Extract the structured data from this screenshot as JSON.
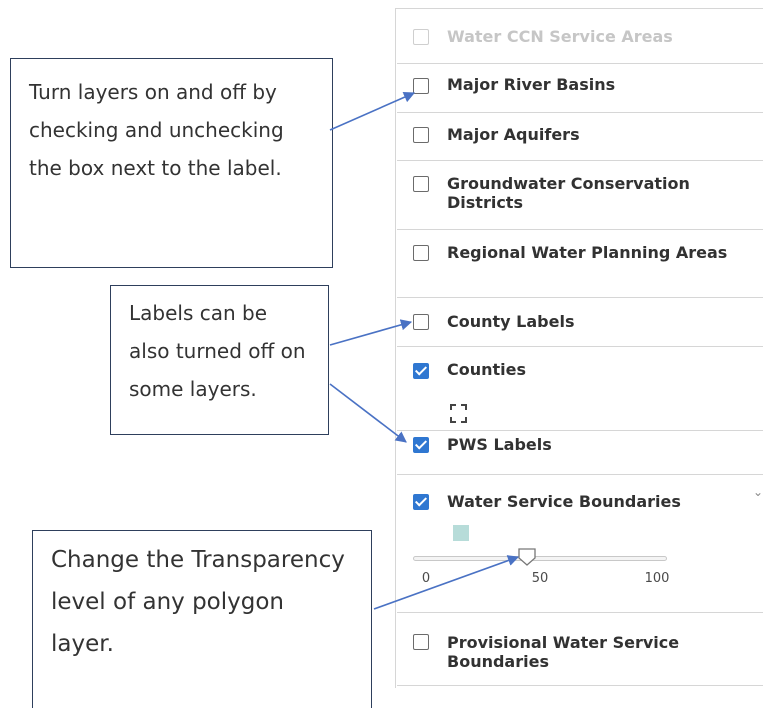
{
  "layers": [
    {
      "label": "Water CCN Service Areas",
      "checked": false,
      "disabled": true
    },
    {
      "label": "Major River Basins",
      "checked": false,
      "disabled": false
    },
    {
      "label": "Major Aquifers",
      "checked": false,
      "disabled": false
    },
    {
      "label": "Groundwater Conservation Districts",
      "checked": false,
      "disabled": false
    },
    {
      "label": "Regional Water Planning Areas",
      "checked": false,
      "disabled": false
    },
    {
      "label": "County Labels",
      "checked": false,
      "disabled": false
    },
    {
      "label": "Counties",
      "checked": true,
      "disabled": false
    },
    {
      "label": "PWS Labels",
      "checked": true,
      "disabled": false
    },
    {
      "label": "Water Service Boundaries",
      "checked": true,
      "disabled": false
    },
    {
      "label": "Provisional Water Service Boundaries",
      "checked": false,
      "disabled": false
    }
  ],
  "transparency_slider": {
    "value": 45,
    "min_label": "0",
    "mid_label": "50",
    "max_label": "100"
  },
  "swatch_color": "#b7dcd9",
  "accent_color": "#2f77d1",
  "callouts": {
    "toggle": "Turn layers on and off by checking and unchecking the box next to the label.",
    "labels": "Labels can be also turned off on some layers.",
    "transparency": "Change the Transparency level of any polygon layer."
  },
  "icons": {
    "counties_legend": "dashed-square-icon",
    "slider_handle": "pentagon-handle-icon",
    "expand": "chevron-down-icon"
  }
}
